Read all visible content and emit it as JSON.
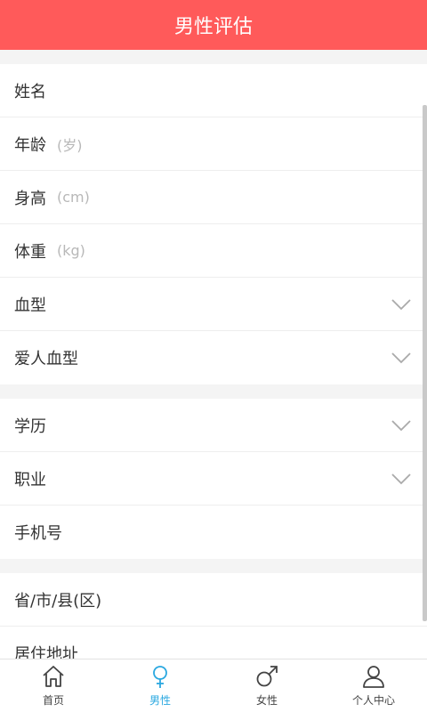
{
  "header": {
    "title": "男性评估"
  },
  "form": {
    "group1": [
      {
        "label": "姓名",
        "hint": "",
        "has_dropdown": false
      },
      {
        "label": "年龄",
        "hint": "(岁)",
        "has_dropdown": false
      },
      {
        "label": "身高",
        "hint": "(cm)",
        "has_dropdown": false
      },
      {
        "label": "体重",
        "hint": "(kg)",
        "has_dropdown": false
      },
      {
        "label": "血型",
        "hint": "",
        "has_dropdown": true
      },
      {
        "label": "爱人血型",
        "hint": "",
        "has_dropdown": true
      }
    ],
    "group2": [
      {
        "label": "学历",
        "hint": "",
        "has_dropdown": true
      },
      {
        "label": "职业",
        "hint": "",
        "has_dropdown": true
      },
      {
        "label": "手机号",
        "hint": "",
        "has_dropdown": false
      }
    ],
    "group3": [
      {
        "label": "省/市/县(区)",
        "hint": "",
        "has_dropdown": false
      },
      {
        "label": "居住地址",
        "hint": "",
        "has_dropdown": false
      }
    ]
  },
  "tabs": [
    {
      "label": "首页",
      "icon": "home-icon",
      "active": false
    },
    {
      "label": "男性",
      "icon": "female-symbol-icon",
      "active": true
    },
    {
      "label": "女性",
      "icon": "male-symbol-icon",
      "active": false
    },
    {
      "label": "个人中心",
      "icon": "person-icon",
      "active": false
    }
  ],
  "colors": {
    "header_bg": "#ff5a5a",
    "active_tab": "#2aa8e0",
    "hint_text": "#b8b8b8"
  }
}
